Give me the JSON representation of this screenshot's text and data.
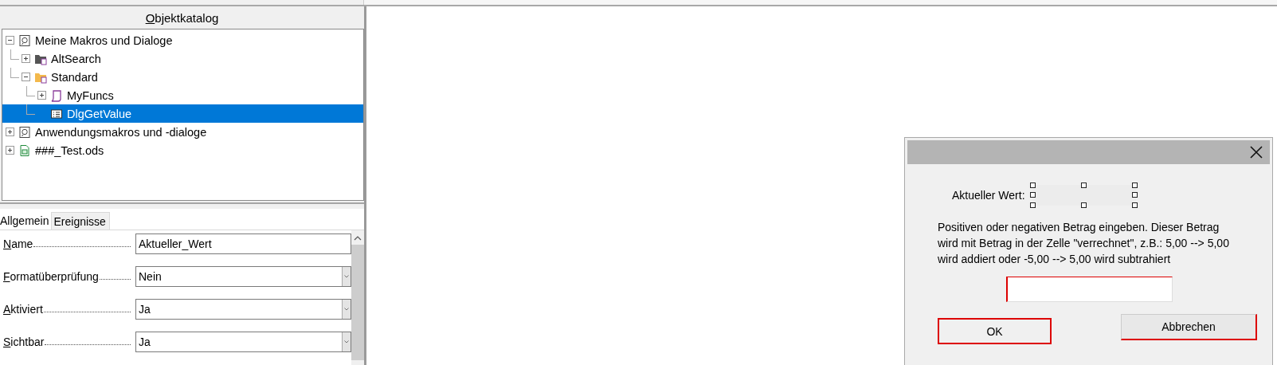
{
  "catalog": {
    "title": "Objektkatalog",
    "tree": [
      {
        "label": "Meine Makros und Dialoge",
        "kind": "library",
        "expanded": true,
        "selected": false,
        "children": [
          {
            "label": "AltSearch",
            "kind": "folder-dark",
            "expanded": false,
            "selected": false
          },
          {
            "label": "Standard",
            "kind": "folder",
            "expanded": true,
            "selected": false,
            "children": [
              {
                "label": "MyFuncs",
                "kind": "module",
                "expanded": false,
                "selected": false
              },
              {
                "label": "DlgGetValue",
                "kind": "dialog",
                "selected": true
              }
            ]
          }
        ]
      },
      {
        "label": "Anwendungsmakros und -dialoge",
        "kind": "library",
        "expanded": false,
        "selected": false
      },
      {
        "label": "###_Test.ods",
        "kind": "document",
        "expanded": false,
        "selected": false
      }
    ]
  },
  "properties": {
    "tabs": [
      {
        "label": "Allgemein",
        "selected": true
      },
      {
        "label": "Ereignisse",
        "selected": false
      }
    ],
    "rows": [
      {
        "label": "Name",
        "kind": "text",
        "value": "Aktueller_Wert"
      },
      {
        "label": "Formatüberprüfung",
        "kind": "dropdown",
        "value": "Nein"
      },
      {
        "label": "Aktiviert",
        "kind": "dropdown",
        "value": "Ja"
      },
      {
        "label": "Sichtbar",
        "kind": "dropdown",
        "value": "Ja"
      }
    ]
  },
  "dialog": {
    "label": "Aktueller Wert:",
    "description": "Positiven oder negativen Betrag eingeben. Dieser Betrag wird mit Betrag in der Zelle \"verrechnet\", z.B.: 5,00 --> 5,00 wird addiert oder -5,00 --> 5,00 wird subtrahiert",
    "buttons": [
      {
        "label": "OK",
        "focused": true
      },
      {
        "label": "Abbrechen",
        "focused": false
      }
    ]
  }
}
